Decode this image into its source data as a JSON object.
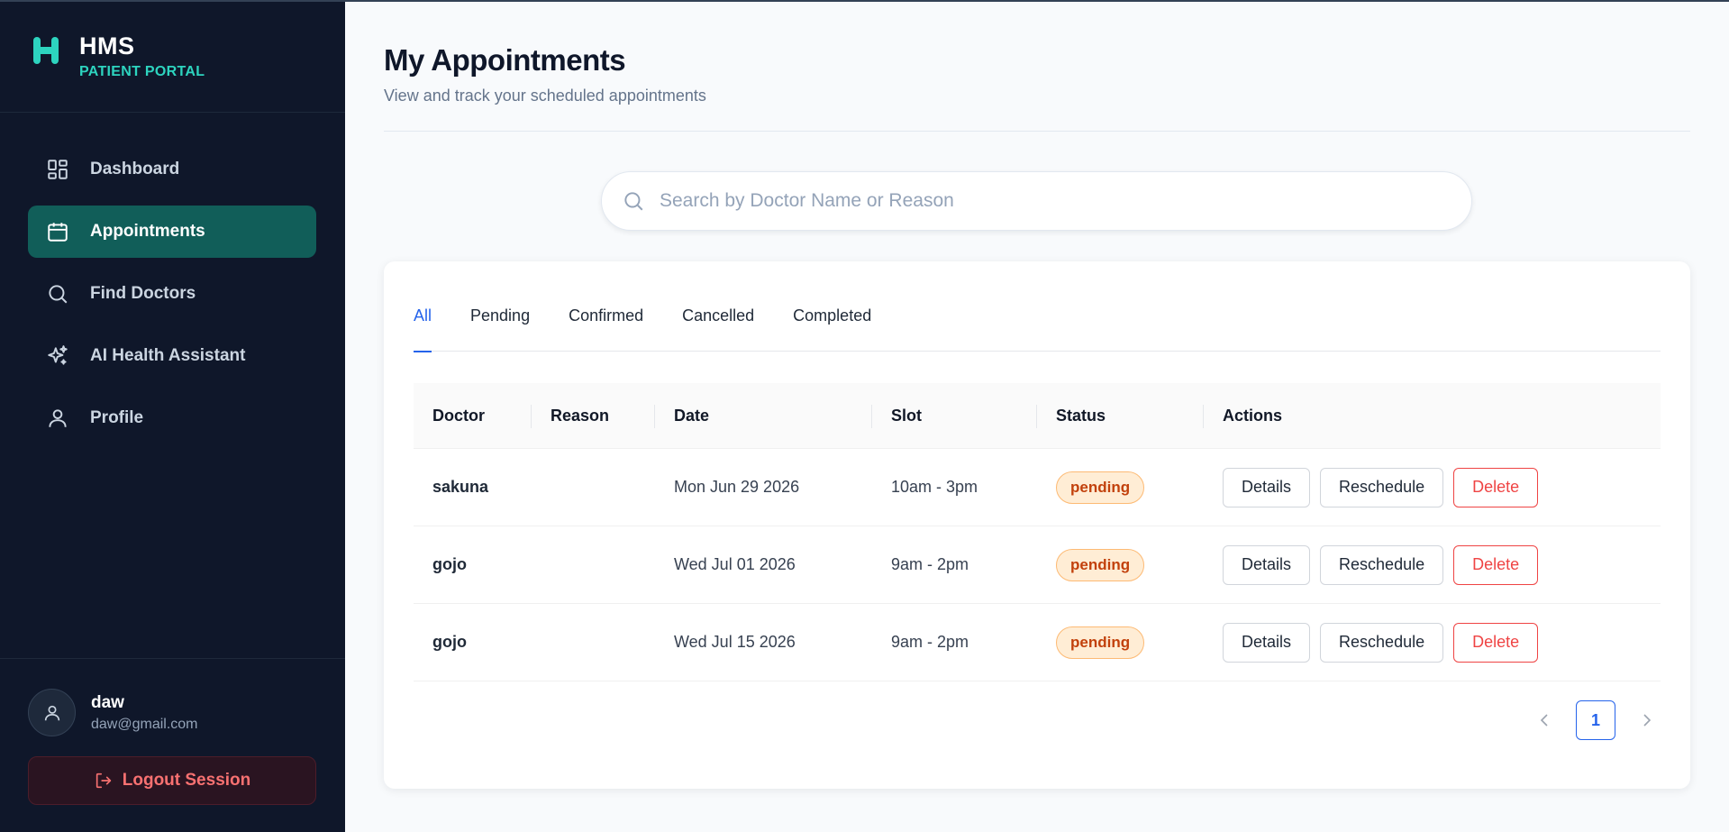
{
  "brand": {
    "name": "HMS",
    "subtitle": "PATIENT PORTAL",
    "accent": "#2dd4bf"
  },
  "sidebar": {
    "items": [
      {
        "label": "Dashboard",
        "icon": "grid-icon",
        "active": false
      },
      {
        "label": "Appointments",
        "icon": "calendar-icon",
        "active": true
      },
      {
        "label": "Find Doctors",
        "icon": "search-icon",
        "active": false
      },
      {
        "label": "AI Health Assistant",
        "icon": "sparkles-icon",
        "active": false
      },
      {
        "label": "Profile",
        "icon": "user-icon",
        "active": false
      }
    ],
    "active_color": "#115e59"
  },
  "user": {
    "name": "daw",
    "email": "daw@gmail.com"
  },
  "logout": {
    "label": "Logout Session"
  },
  "main": {
    "title": "My Appointments",
    "subtitle": "View and track your scheduled appointments"
  },
  "search": {
    "placeholder": "Search by Doctor Name or Reason",
    "value": ""
  },
  "tabs": [
    {
      "label": "All",
      "active": true
    },
    {
      "label": "Pending",
      "active": false
    },
    {
      "label": "Confirmed",
      "active": false
    },
    {
      "label": "Cancelled",
      "active": false
    },
    {
      "label": "Completed",
      "active": false
    }
  ],
  "table": {
    "columns": [
      "Doctor",
      "Reason",
      "Date",
      "Slot",
      "Status",
      "Actions"
    ],
    "rows": [
      {
        "doctor": "sakuna",
        "reason": "",
        "date": "Mon Jun 29 2026",
        "slot": "10am - 3pm",
        "status": "pending"
      },
      {
        "doctor": "gojo",
        "reason": "",
        "date": "Wed Jul 01 2026",
        "slot": "9am - 2pm",
        "status": "pending"
      },
      {
        "doctor": "gojo",
        "reason": "",
        "date": "Wed Jul 15 2026",
        "slot": "9am - 2pm",
        "status": "pending"
      }
    ],
    "actions": {
      "details": "Details",
      "reschedule": "Reschedule",
      "delete": "Delete"
    }
  },
  "pagination": {
    "current": "1"
  }
}
